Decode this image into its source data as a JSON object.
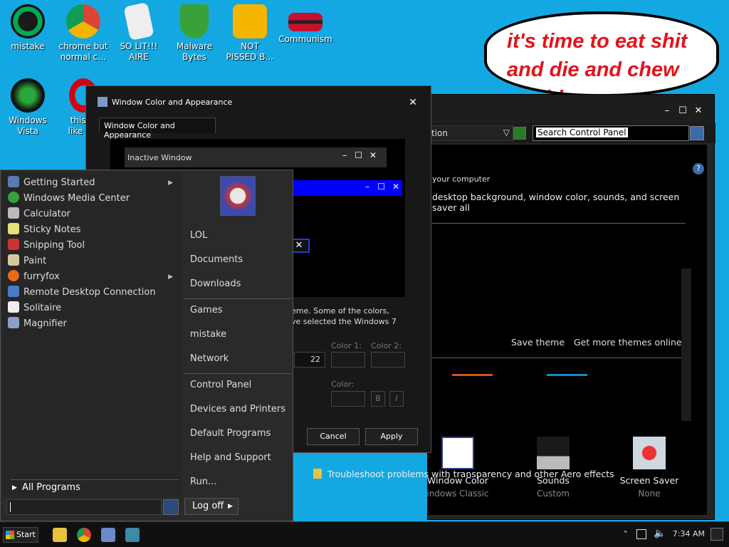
{
  "desktop": {
    "icons": [
      {
        "label_1": "mistake",
        "label_2": "",
        "icon": "green-ring-icon"
      },
      {
        "label_1": "chrome but",
        "label_2": "normal c…",
        "icon": "chrome-icon"
      },
      {
        "label_1": "SO LIT!!!",
        "label_2": "AIRE",
        "icon": "card-icon"
      },
      {
        "label_1": "Malware",
        "label_2": "Bytes",
        "icon": "shield-icon"
      },
      {
        "label_1": "NOT",
        "label_2": "PISSED B…",
        "icon": "pig-icon"
      },
      {
        "label_1": "Communism",
        "label_2": "",
        "icon": "communism-icon"
      },
      {
        "label_1": "Windows",
        "label_2": "Vista",
        "icon": "recycle-icon"
      },
      {
        "label_1": "this lo",
        "label_2": "like a v",
        "icon": "opera-icon"
      }
    ],
    "speech_bubble": "it's time to eat shit and die and chew bubble gum"
  },
  "control_panel": {
    "location": "tion",
    "search": "Search Control Panel",
    "subtitle": "your computer",
    "description": "desktop background, window color, sounds, and screen saver all",
    "save_theme": "Save theme",
    "more_themes": "Get more themes online",
    "items": [
      {
        "label": "Window Color",
        "sub": "indows Classic"
      },
      {
        "label": "Sounds",
        "sub": "Custom"
      },
      {
        "label": "Screen Saver",
        "sub": "None"
      }
    ],
    "troubleshoot": "Troubleshoot problems with transparency and other Aero effects"
  },
  "window_color": {
    "title": "Window Color and Appearance",
    "tab": "Window Color and Appearance",
    "inactive_window": "Inactive Window",
    "text_1": "eme.  Some of the colors,",
    "text_2": "ve selected the Windows 7",
    "color1": "Color 1:",
    "color2": "Color 2:",
    "color": "Color:",
    "size_value": "22",
    "cancel": "Cancel",
    "apply": "Apply",
    "bold": "B",
    "italic": "I"
  },
  "start_menu": {
    "left_items": [
      {
        "label": "Getting Started",
        "arrow": "▶"
      },
      {
        "label": "Windows Media Center",
        "arrow": ""
      },
      {
        "label": "Calculator",
        "arrow": ""
      },
      {
        "label": "Sticky Notes",
        "arrow": ""
      },
      {
        "label": "Snipping Tool",
        "arrow": ""
      },
      {
        "label": "Paint",
        "arrow": ""
      },
      {
        "label": "furryfox",
        "arrow": "▶"
      },
      {
        "label": "Remote Desktop Connection",
        "arrow": ""
      },
      {
        "label": "Solitaire",
        "arrow": ""
      },
      {
        "label": "Magnifier",
        "arrow": ""
      }
    ],
    "all_programs": "All Programs",
    "right_items": [
      "LOL",
      "Documents",
      "Downloads",
      "Games",
      "mistake",
      "Network",
      "Control Panel",
      "Devices and Printers",
      "Default Programs",
      "Help and Support",
      "Run..."
    ],
    "log_off": "Log off"
  },
  "taskbar": {
    "start": "Start",
    "clock": "7:34 AM"
  }
}
